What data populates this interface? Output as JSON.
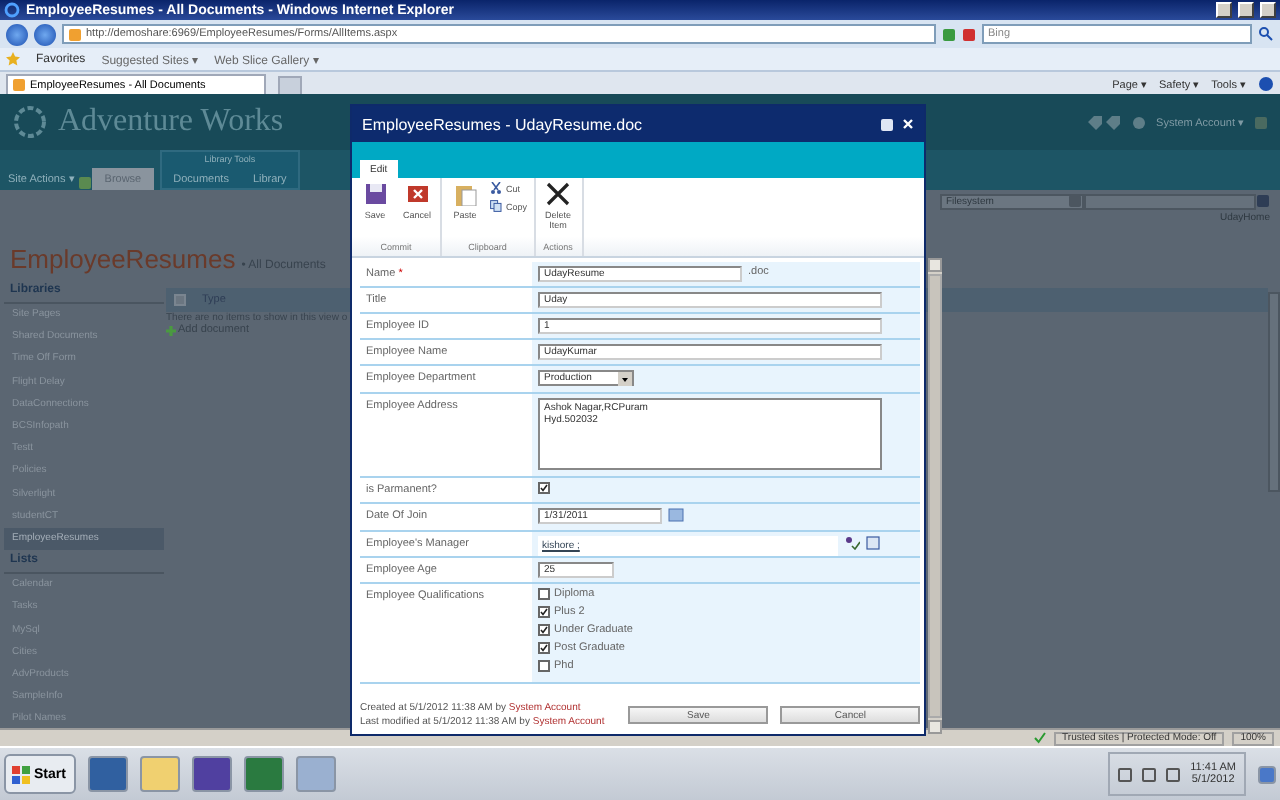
{
  "browser": {
    "title": "EmployeeResumes - All Documents - Windows Internet Explorer",
    "url": "http://demoshare:6969/EmployeeResumes/Forms/AllItems.aspx",
    "search_placeholder": "Bing",
    "favorites": "Favorites",
    "favorite_links": [
      "Suggested Sites ▾",
      "Web Slice Gallery ▾"
    ],
    "tab": "EmployeeResumes - All Documents",
    "commands": [
      "Page ▾",
      "Safety ▾",
      "Tools ▾"
    ]
  },
  "site": {
    "logo": "Adventure Works",
    "user": "System Account ▾",
    "site_actions": "Site Actions ▾",
    "tool_group": "Library Tools",
    "ribbon_tabs": [
      {
        "label": "Browse",
        "selected": true
      },
      {
        "label": "Documents",
        "selected": false
      },
      {
        "label": "Library",
        "selected": false
      }
    ],
    "search_scope": "Filesystem",
    "page_title": "EmployeeResumes",
    "view": "• All Documents",
    "breadcrumb": "UdayHome",
    "nav": [
      {
        "heading": "Libraries",
        "items": [
          {
            "label": "Site Pages",
            "selected": false
          },
          {
            "label": "Shared Documents",
            "selected": false
          },
          {
            "label": "Time Off Form",
            "selected": false
          },
          {
            "label": "Flight Delay",
            "selected": false
          },
          {
            "label": "DataConnections",
            "selected": false
          },
          {
            "label": "BCSInfopath",
            "selected": false
          },
          {
            "label": "Testt",
            "selected": false
          },
          {
            "label": "Policies",
            "selected": false
          },
          {
            "label": "Silverlight",
            "selected": false
          },
          {
            "label": "studentCT",
            "selected": false
          },
          {
            "label": "EmployeeResumes",
            "selected": true
          }
        ]
      },
      {
        "heading": "Lists",
        "items": [
          {
            "label": "Calendar",
            "selected": false
          },
          {
            "label": "Tasks",
            "selected": false
          },
          {
            "label": "MySql",
            "selected": false
          },
          {
            "label": "Cities",
            "selected": false
          },
          {
            "label": "AdvProducts",
            "selected": false
          },
          {
            "label": "SampleInfo",
            "selected": false
          },
          {
            "label": "Pilot Names",
            "selected": false
          }
        ]
      }
    ],
    "select_all": {
      "checked": false
    },
    "columns": [
      "Type"
    ],
    "empty_message": "There are no items to show in this view o",
    "add_document": "Add document"
  },
  "dialog": {
    "title": "EmployeeResumes - UdayResume.doc",
    "tabs": [
      {
        "label": "Edit",
        "selected": true
      }
    ],
    "groups": [
      {
        "label": "Commit",
        "buttons": [
          {
            "kind": "save",
            "label": "Save"
          },
          {
            "kind": "cancel",
            "label": "Cancel"
          }
        ]
      },
      {
        "label": "Clipboard",
        "buttons": [
          {
            "kind": "paste",
            "label": "Paste"
          },
          {
            "kind": "cut",
            "label": "Cut"
          },
          {
            "kind": "copy",
            "label": "Copy"
          }
        ]
      },
      {
        "label": "Actions",
        "buttons": [
          {
            "kind": "delete",
            "label": "Delete Item"
          }
        ]
      }
    ],
    "fields": [
      {
        "kind": "text",
        "label": "Name",
        "required_mark": "*",
        "value": "UdayResume",
        "suffix": ".doc"
      },
      {
        "kind": "text",
        "label": "Title",
        "value": "Uday"
      },
      {
        "kind": "text",
        "label": "Employee ID",
        "value": "1"
      },
      {
        "kind": "text",
        "label": "Employee Name",
        "value": "UdayKumar"
      },
      {
        "kind": "select",
        "label": "Employee Department",
        "value": "Production"
      },
      {
        "kind": "textarea",
        "label": "Employee Address",
        "lines": [
          "Ashok Nagar,RCPuram",
          "Hyd.502032"
        ]
      },
      {
        "kind": "checkbox",
        "label": "is Parmanent?",
        "checked": true
      },
      {
        "kind": "date",
        "label": "Date Of Join",
        "value": "1/31/2011"
      },
      {
        "kind": "people",
        "label": "Employee's Manager",
        "value": "kishore ;"
      },
      {
        "kind": "short",
        "label": "Employee Age",
        "value": "25"
      },
      {
        "kind": "choices",
        "label": "Employee Qualifications",
        "options": [
          {
            "label": "Diploma",
            "checked": false
          },
          {
            "label": "Plus 2",
            "checked": true
          },
          {
            "label": "Under Graduate",
            "checked": true
          },
          {
            "label": "Post Graduate",
            "checked": true
          },
          {
            "label": "Phd",
            "checked": false
          }
        ]
      }
    ],
    "created": "Created at 5/1/2012 11:38 AM by",
    "created_by": "System Account",
    "modified": "Last modified at 5/1/2012 11:38 AM by",
    "modified_by": "System Account",
    "buttons": [
      "Save",
      "Cancel"
    ]
  },
  "status_bar": {
    "zone": "Trusted sites | Protected Mode: Off",
    "zoom": "100%"
  },
  "taskbar": {
    "start": "Start",
    "time": "11:41 AM",
    "date": "5/1/2012"
  }
}
